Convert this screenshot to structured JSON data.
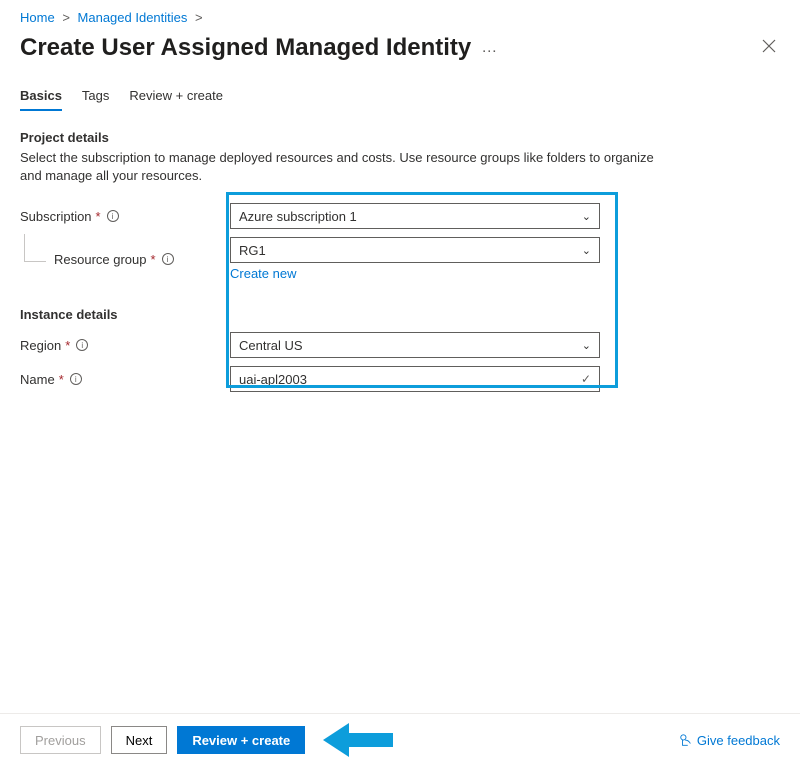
{
  "breadcrumb": {
    "home": "Home",
    "mi": "Managed Identities"
  },
  "header": {
    "title": "Create User Assigned Managed Identity",
    "more": "…"
  },
  "tabs": {
    "basics": "Basics",
    "tags": "Tags",
    "review": "Review + create"
  },
  "section": {
    "project_title": "Project details",
    "project_desc": "Select the subscription to manage deployed resources and costs. Use resource groups like folders to organize and manage all your resources.",
    "instance_title": "Instance details"
  },
  "labels": {
    "subscription": "Subscription",
    "resource_group": "Resource group",
    "create_new": "Create new",
    "region": "Region",
    "name": "Name"
  },
  "values": {
    "subscription": "Azure subscription 1",
    "resource_group": "RG1",
    "region": "Central US",
    "name": "uai-apl2003"
  },
  "footer": {
    "previous": "Previous",
    "next": "Next",
    "review_create": "Review + create",
    "feedback": "Give feedback"
  }
}
